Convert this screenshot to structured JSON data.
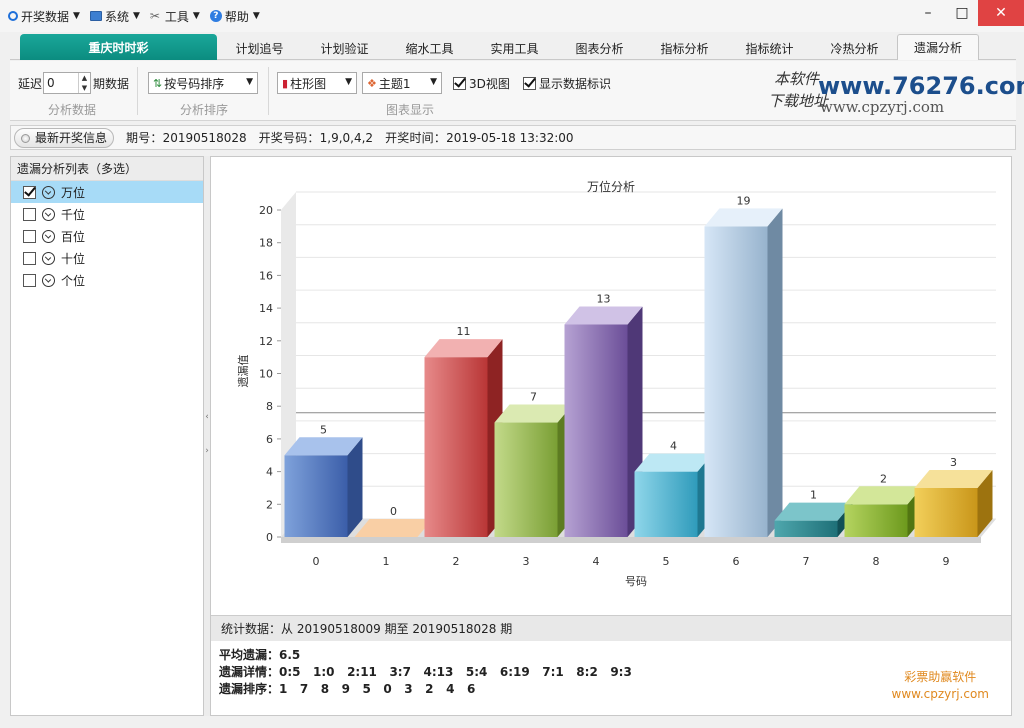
{
  "menu": {
    "items": [
      {
        "label": "开奖数据",
        "icon": "circle-icon"
      },
      {
        "label": "系统",
        "icon": "monitor-icon"
      },
      {
        "label": "工具",
        "icon": "tools-icon"
      },
      {
        "label": "帮助",
        "icon": "help-icon"
      }
    ]
  },
  "window_controls": {
    "minimize": "–",
    "maximize": "□",
    "close": "✕"
  },
  "tabs": [
    "重庆时时彩",
    "计划追号",
    "计划验证",
    "缩水工具",
    "实用工具",
    "图表分析",
    "指标分析",
    "指标统计",
    "冷热分析",
    "遗漏分析"
  ],
  "toolbar": {
    "delay_label": "延迟",
    "delay_value": "0",
    "period_label": "期数据",
    "group1_label": "分析数据",
    "sort_combo": "按号码排序",
    "group2_label": "分析排序",
    "chart_type_combo": "柱形图",
    "theme_combo": "主题1",
    "view3d_label": "3D视图",
    "show_labels_label": "显示数据标识",
    "group3_label": "图表显示"
  },
  "watermark": {
    "hand1": "本软件",
    "hand2": "下载地址",
    "url": "www.76276.com",
    "url2": "www.cpzyrj.com"
  },
  "infobar": {
    "button": "最新开奖信息",
    "issue_label": "期号：",
    "issue": "20190518028",
    "draw_label": "开奖号码：",
    "draw": "1,9,0,4,2",
    "time_label": "开奖时间：",
    "time": "2019-05-18 13:32:00"
  },
  "leftpanel": {
    "title": "遗漏分析列表（多选）",
    "items": [
      {
        "label": "万位",
        "checked": true
      },
      {
        "label": "千位",
        "checked": false
      },
      {
        "label": "百位",
        "checked": false
      },
      {
        "label": "十位",
        "checked": false
      },
      {
        "label": "个位",
        "checked": false
      }
    ]
  },
  "chart_data": {
    "type": "bar",
    "title": "万位分析",
    "xlabel": "号码",
    "ylabel": "遗漏值",
    "categories": [
      "0",
      "1",
      "2",
      "3",
      "4",
      "5",
      "6",
      "7",
      "8",
      "9"
    ],
    "values": [
      5,
      0,
      11,
      7,
      13,
      4,
      19,
      1,
      2,
      3
    ],
    "ylim": [
      0,
      20
    ],
    "yticks": [
      0,
      2,
      4,
      6,
      8,
      10,
      12,
      14,
      16,
      18,
      20
    ],
    "average_line": 6.5,
    "view_3d": true,
    "colors": [
      [
        "#7fa2db",
        "#3b5ea9",
        "#2f4c8a",
        "#a8c2ec"
      ],
      [
        "#f6b27a",
        "#e0812d",
        "#b9651c",
        "#f9cfa5"
      ],
      [
        "#e78a8a",
        "#b93636",
        "#8e2323",
        "#f2b1b1"
      ],
      [
        "#c3da8a",
        "#7a9f34",
        "#5d7c22",
        "#dbeab2"
      ],
      [
        "#b6a2d3",
        "#6b4e98",
        "#4f3877",
        "#d0c2e6"
      ],
      [
        "#8fd6ea",
        "#2f9bbb",
        "#1f7891",
        "#bde8f4"
      ],
      [
        "#d6e6f6",
        "#97b3cd",
        "#6f8aa3",
        "#e6f0fa"
      ],
      [
        "#4fa7ad",
        "#1e7078",
        "#125057",
        "#7cc5ca"
      ],
      [
        "#b5d460",
        "#6d9a1d",
        "#527612",
        "#d3e799"
      ],
      [
        "#f2cf5a",
        "#c9961a",
        "#9d730f",
        "#f6e19a"
      ]
    ]
  },
  "stats": {
    "head": "统计数据：从 20190518009 期至 20190518028 期",
    "avg": "平均遗漏：6.5",
    "detail": "遗漏详情：0:5   1:0   2:11   3:7   4:13   5:4   6:19   7:1   8:2   9:3",
    "rank": "遗漏排序：1   7   8   9   5   0   3   2   4   6",
    "sig1": "彩票助赢软件",
    "sig2": "www.cpzyrj.com"
  }
}
